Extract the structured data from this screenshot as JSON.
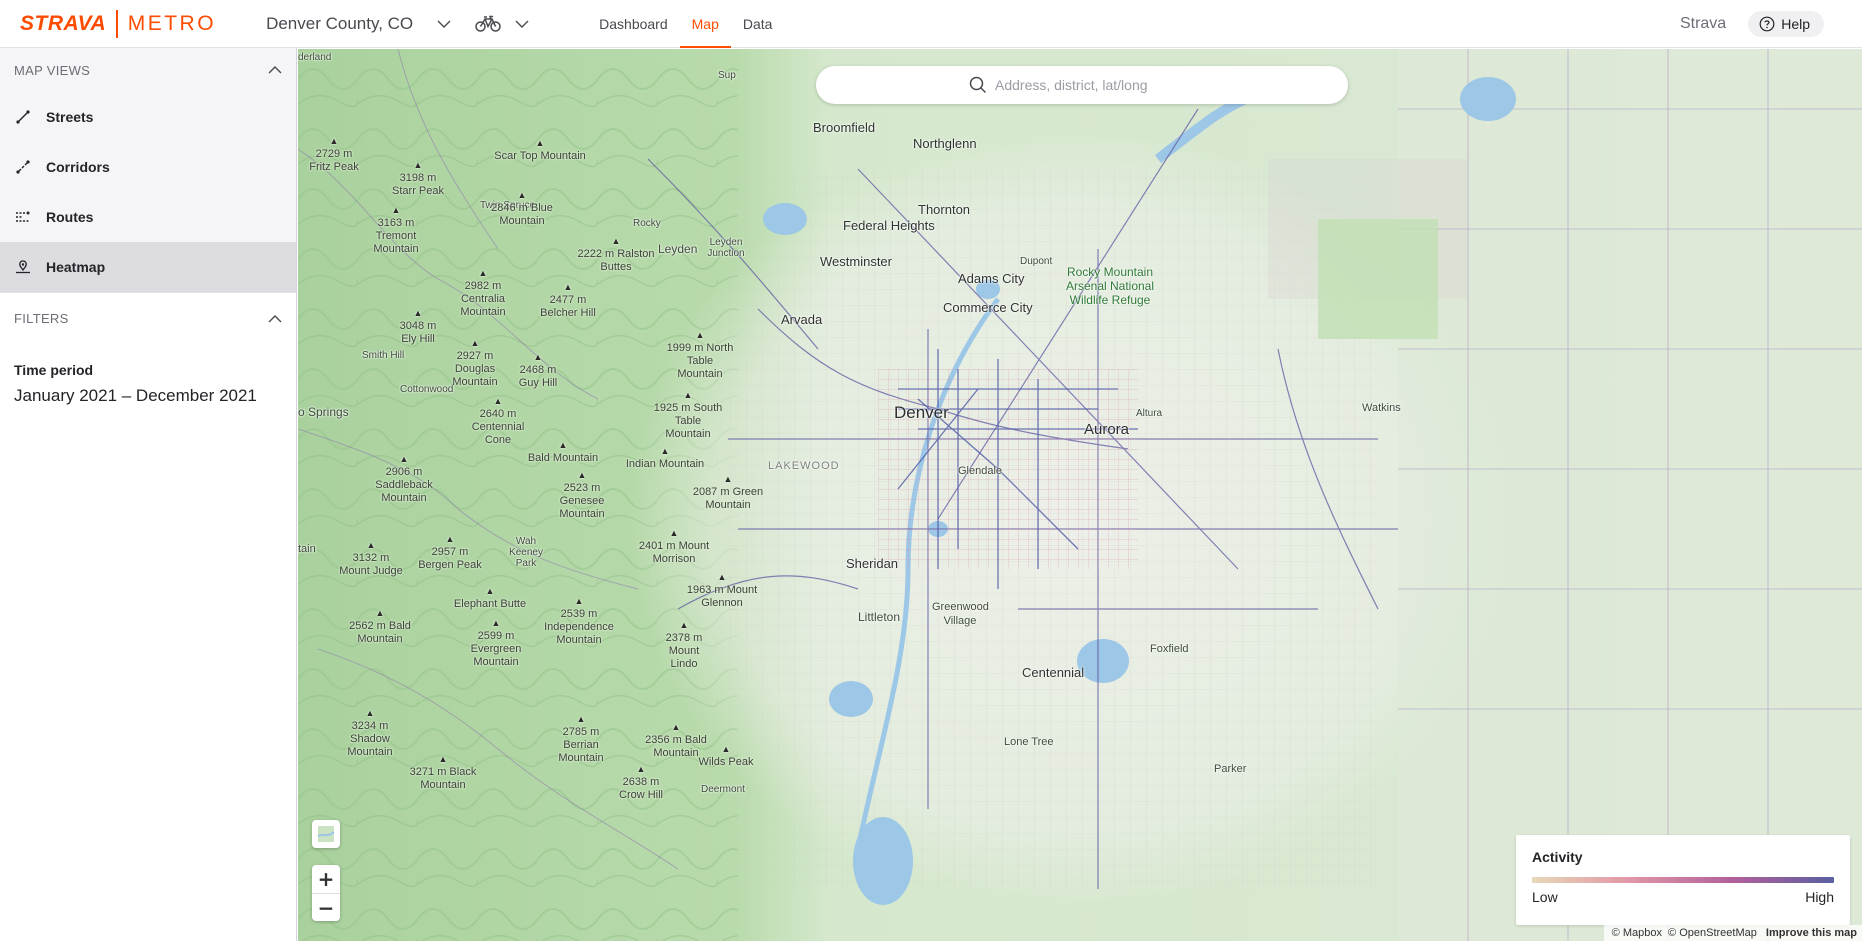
{
  "brand": {
    "name": "STRAVA",
    "product": "METRO",
    "color": "#fc4c02"
  },
  "header": {
    "region": "Denver County, CO",
    "activity_icon": "bike-icon",
    "tabs": [
      {
        "label": "Dashboard",
        "active": false
      },
      {
        "label": "Map",
        "active": true
      },
      {
        "label": "Data",
        "active": false
      }
    ],
    "strava_link": "Strava",
    "help_label": "Help"
  },
  "sidebar": {
    "map_views_title": "MAP VIEWS",
    "views": [
      {
        "label": "Streets",
        "icon": "street-line-icon",
        "active": false
      },
      {
        "label": "Corridors",
        "icon": "corridor-icon",
        "active": false
      },
      {
        "label": "Routes",
        "icon": "routes-icon",
        "active": false
      },
      {
        "label": "Heatmap",
        "icon": "heatmap-icon",
        "active": true
      }
    ],
    "filters_title": "FILTERS",
    "time_period_label": "Time period",
    "time_period_value": "January 2021 – December 2021"
  },
  "map": {
    "search_placeholder": "Address, district, lat/long",
    "places": {
      "broomfield": "Broomfield",
      "northglenn": "Northglenn",
      "thornton": "Thornton",
      "federal_heights": "Federal Heights",
      "leyden": "Leyden",
      "leyden_junction": "Leyden Junction",
      "westminster": "Westminster",
      "dupont": "Dupont",
      "adams_city": "Adams City",
      "commerce_city": "Commerce City",
      "arvada": "Arvada",
      "denver": "Denver",
      "aurora": "Aurora",
      "altura": "Altura",
      "watkins": "Watkins",
      "lakewood": "LAKEWOOD",
      "glendale": "Glendale",
      "sheridan": "Sheridan",
      "greenwood_village": "Greenwood Village",
      "littleton": "Littleton",
      "centennial": "Centennial",
      "foxfield": "Foxfield",
      "lone_tree": "Lone Tree",
      "parker": "Parker",
      "rocky": "Rocky",
      "refuge": "Rocky Mountain Arsenal National Wildlife Refuge",
      "twin_spruce": "Twin Spruce",
      "smith_hill": "Smith Hill",
      "cottonwood": "Cottonwood",
      "wah_keeney_park": "Wah Keeney Park",
      "derland": "derland",
      "sup": "Sup",
      "o_springs": "o Springs",
      "tain": "tain",
      "deermont": "Deermont"
    },
    "peaks": [
      {
        "id": "fritz",
        "label": "2729 m Fritz Peak"
      },
      {
        "id": "starr",
        "label": "3198 m Starr Peak"
      },
      {
        "id": "scartop",
        "label": "Scar Top Mountain"
      },
      {
        "id": "blue",
        "label": "2846 m Blue Mountain"
      },
      {
        "id": "tremont",
        "label": "3163 m Tremont Mountain"
      },
      {
        "id": "ralston",
        "label": "2222 m Ralston Buttes"
      },
      {
        "id": "centralia",
        "label": "2982 m Centralia Mountain"
      },
      {
        "id": "belcher",
        "label": "2477 m Belcher Hill"
      },
      {
        "id": "ely",
        "label": "3048 m Ely Hill"
      },
      {
        "id": "northtable",
        "label": "1999 m North Table Mountain"
      },
      {
        "id": "douglas",
        "label": "2927 m Douglas Mountain"
      },
      {
        "id": "guy",
        "label": "2468 m Guy Hill"
      },
      {
        "id": "southtable",
        "label": "1925 m South Table Mountain"
      },
      {
        "id": "centennialcone",
        "label": "2640 m Centennial Cone"
      },
      {
        "id": "bald1",
        "label": "Bald Mountain"
      },
      {
        "id": "indian",
        "label": "Indian Mountain"
      },
      {
        "id": "saddleback",
        "label": "2906 m Saddleback Mountain"
      },
      {
        "id": "genesee",
        "label": "2523 m Genesee Mountain"
      },
      {
        "id": "greenmtn",
        "label": "2087 m Green Mountain"
      },
      {
        "id": "morrison",
        "label": "2401 m Mount Morrison"
      },
      {
        "id": "judge",
        "label": "3132 m Mount Judge"
      },
      {
        "id": "bergen",
        "label": "2957 m Bergen Peak"
      },
      {
        "id": "glennon",
        "label": "1963 m Mount Glennon"
      },
      {
        "id": "elephant",
        "label": "Elephant Butte"
      },
      {
        "id": "independence",
        "label": "2539 m Independence Mountain"
      },
      {
        "id": "bald2",
        "label": "2562 m Bald Mountain"
      },
      {
        "id": "evergreen",
        "label": "2599 m Evergreen Mountain"
      },
      {
        "id": "lindo",
        "label": "2378 m Mount Lindo"
      },
      {
        "id": "shadow",
        "label": "3234 m Shadow Mountain"
      },
      {
        "id": "berrian",
        "label": "2785 m Berrian Mountain"
      },
      {
        "id": "bald3",
        "label": "2356 m Bald Mountain"
      },
      {
        "id": "wilds",
        "label": "Wilds Peak"
      },
      {
        "id": "blackmtn",
        "label": "3271 m Black Mountain"
      },
      {
        "id": "crowhill",
        "label": "2638 m Crow Hill"
      }
    ],
    "legend": {
      "title": "Activity",
      "low": "Low",
      "high": "High",
      "gradient": [
        "#e7d9b8",
        "#e094a6",
        "#b0609a",
        "#5a5fa0"
      ]
    },
    "attribution": {
      "mapbox": "© Mapbox",
      "osm": "© OpenStreetMap",
      "improve": "Improve this map"
    },
    "colors": {
      "land": "#dde9d6",
      "forest": "#b9d9ae",
      "water": "#9dc7e6",
      "urban": "#eef0ea",
      "heat_low": "#e3a4b0",
      "heat_high": "#4c58a6"
    }
  }
}
